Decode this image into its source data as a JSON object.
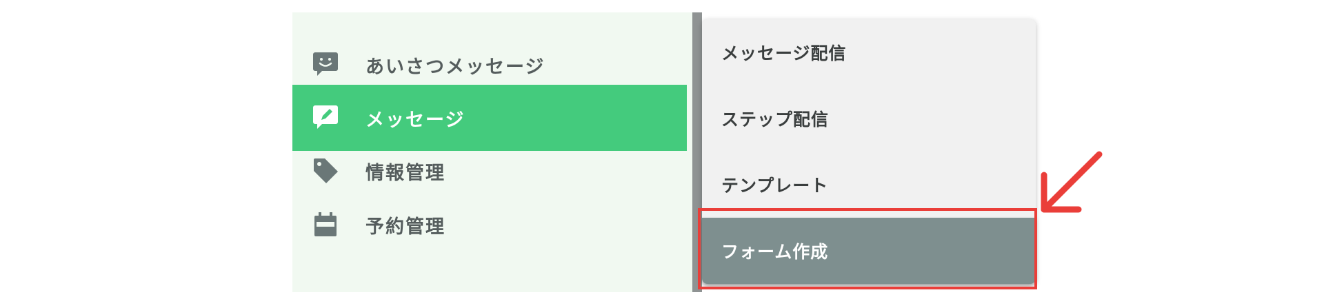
{
  "sidebar": {
    "items": [
      {
        "label": "あいさつメッセージ",
        "icon": "smile-chat-icon",
        "active": false
      },
      {
        "label": "メッセージ",
        "icon": "edit-chat-icon",
        "active": true
      },
      {
        "label": "情報管理",
        "icon": "tag-icon",
        "active": false
      },
      {
        "label": "予約管理",
        "icon": "calendar-icon",
        "active": false
      }
    ]
  },
  "submenu": {
    "items": [
      {
        "label": "メッセージ配信",
        "selected": false
      },
      {
        "label": "ステップ配信",
        "selected": false
      },
      {
        "label": "テンプレート",
        "selected": false
      },
      {
        "label": "フォーム作成",
        "selected": true
      }
    ]
  },
  "colors": {
    "accent_green": "#44cb7d",
    "sidebar_bg": "#f1f9f1",
    "selected_bg": "#7e8f8f",
    "highlight_red": "#ea3e39"
  }
}
